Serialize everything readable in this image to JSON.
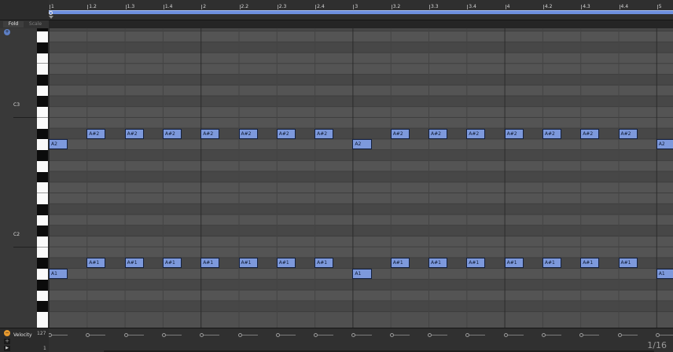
{
  "header": {
    "fold_label": "Fold",
    "scale_label": "Scale"
  },
  "ruler": {
    "bar_labels": [
      "1",
      "1.2",
      "1.3",
      "1.4",
      "2",
      "2.2",
      "2.3",
      "2.4",
      "3",
      "3.2",
      "3.3",
      "3.4",
      "4",
      "4.2",
      "4.3",
      "4.4",
      "5"
    ]
  },
  "keyboard": {
    "octave_labels": [
      {
        "label": "C3",
        "pitch": 48
      },
      {
        "label": "C2",
        "pitch": 36
      }
    ]
  },
  "notes": [
    {
      "label": "A2",
      "pitch": 45,
      "start": 0,
      "length": 0.5
    },
    {
      "label": "A#2",
      "pitch": 46,
      "start": 1,
      "length": 0.5
    },
    {
      "label": "A#2",
      "pitch": 46,
      "start": 2,
      "length": 0.5
    },
    {
      "label": "A#2",
      "pitch": 46,
      "start": 3,
      "length": 0.5
    },
    {
      "label": "A#2",
      "pitch": 46,
      "start": 4,
      "length": 0.5
    },
    {
      "label": "A#2",
      "pitch": 46,
      "start": 5,
      "length": 0.5
    },
    {
      "label": "A#2",
      "pitch": 46,
      "start": 6,
      "length": 0.5
    },
    {
      "label": "A#2",
      "pitch": 46,
      "start": 7,
      "length": 0.5
    },
    {
      "label": "A2",
      "pitch": 45,
      "start": 8,
      "length": 0.5
    },
    {
      "label": "A#2",
      "pitch": 46,
      "start": 9,
      "length": 0.5
    },
    {
      "label": "A#2",
      "pitch": 46,
      "start": 10,
      "length": 0.5
    },
    {
      "label": "A#2",
      "pitch": 46,
      "start": 11,
      "length": 0.5
    },
    {
      "label": "A#2",
      "pitch": 46,
      "start": 12,
      "length": 0.5
    },
    {
      "label": "A#2",
      "pitch": 46,
      "start": 13,
      "length": 0.5
    },
    {
      "label": "A#2",
      "pitch": 46,
      "start": 14,
      "length": 0.5
    },
    {
      "label": "A#2",
      "pitch": 46,
      "start": 15,
      "length": 0.5
    },
    {
      "label": "A2",
      "pitch": 45,
      "start": 16,
      "length": 0.5
    },
    {
      "label": "A1",
      "pitch": 33,
      "start": 0,
      "length": 0.5
    },
    {
      "label": "A#1",
      "pitch": 34,
      "start": 1,
      "length": 0.5
    },
    {
      "label": "A#1",
      "pitch": 34,
      "start": 2,
      "length": 0.5
    },
    {
      "label": "A#1",
      "pitch": 34,
      "start": 3,
      "length": 0.5
    },
    {
      "label": "A#1",
      "pitch": 34,
      "start": 4,
      "length": 0.5
    },
    {
      "label": "A#1",
      "pitch": 34,
      "start": 5,
      "length": 0.5
    },
    {
      "label": "A#1",
      "pitch": 34,
      "start": 6,
      "length": 0.5
    },
    {
      "label": "A#1",
      "pitch": 34,
      "start": 7,
      "length": 0.5
    },
    {
      "label": "A1",
      "pitch": 33,
      "start": 8,
      "length": 0.5
    },
    {
      "label": "A#1",
      "pitch": 34,
      "start": 9,
      "length": 0.5
    },
    {
      "label": "A#1",
      "pitch": 34,
      "start": 10,
      "length": 0.5
    },
    {
      "label": "A#1",
      "pitch": 34,
      "start": 11,
      "length": 0.5
    },
    {
      "label": "A#1",
      "pitch": 34,
      "start": 12,
      "length": 0.5
    },
    {
      "label": "A#1",
      "pitch": 34,
      "start": 13,
      "length": 0.5
    },
    {
      "label": "A#1",
      "pitch": 34,
      "start": 14,
      "length": 0.5
    },
    {
      "label": "A#1",
      "pitch": 34,
      "start": 15,
      "length": 0.5
    },
    {
      "label": "A1",
      "pitch": 33,
      "start": 16,
      "length": 0.5
    }
  ],
  "velocity": {
    "label": "Velocity",
    "max_label": "127",
    "min_label": "1"
  },
  "zoom": {
    "readout": "1/16"
  },
  "colors": {
    "note_fill": "#7d99dc",
    "loop_bar": "#6d8fde",
    "accent_orange": "#e89a2e"
  },
  "icons": {
    "expand": "plus-circle-icon",
    "collapse": "minus-circle-icon",
    "play": "play-icon"
  }
}
